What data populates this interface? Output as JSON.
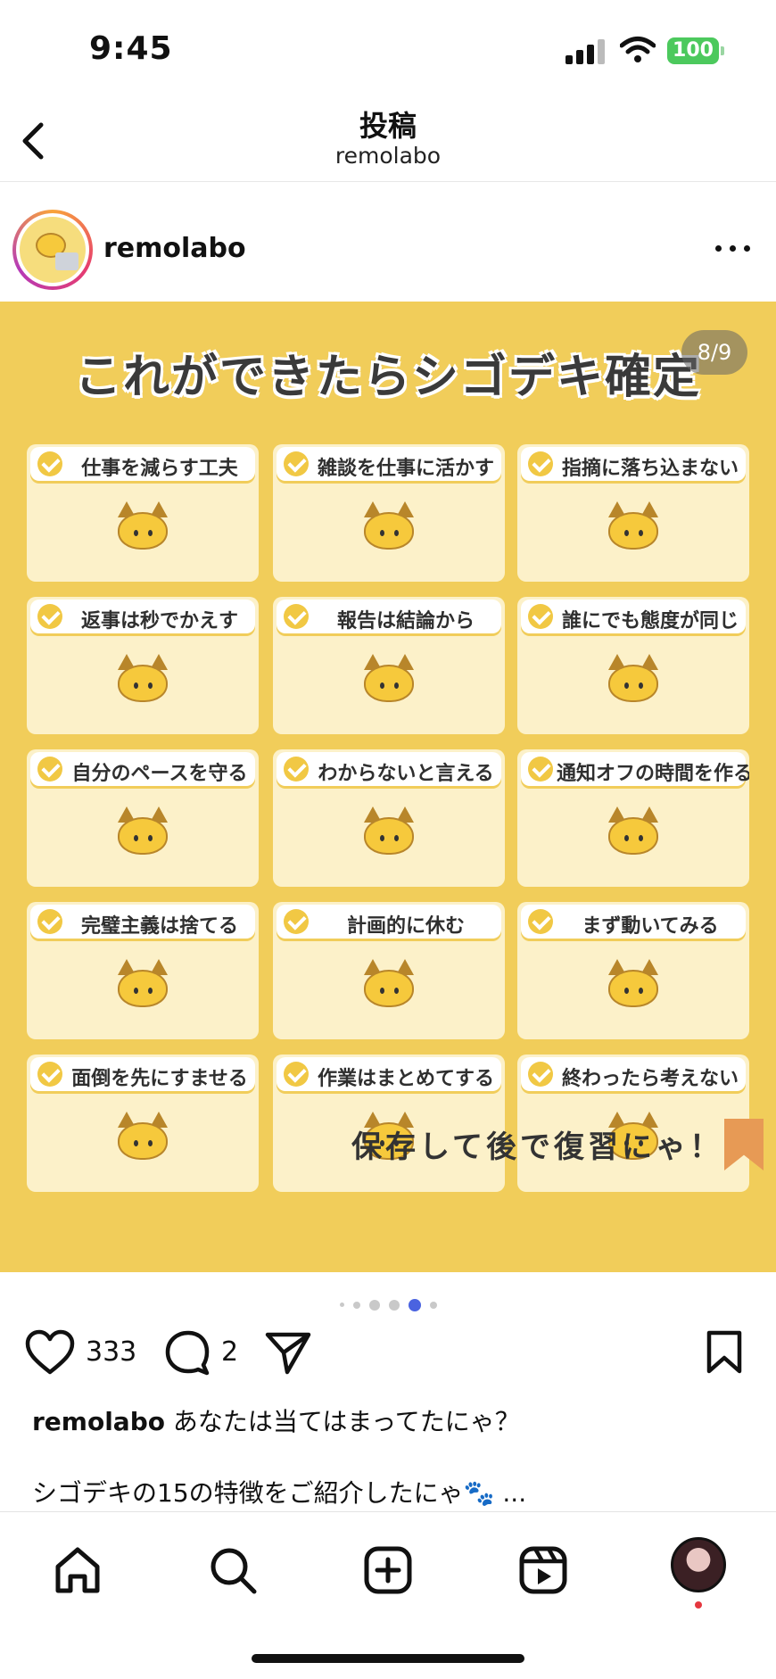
{
  "status_bar": {
    "time": "9:45",
    "battery": "100"
  },
  "header": {
    "title": "投稿",
    "subtitle": "remolabo"
  },
  "post": {
    "username": "remolabo",
    "slide_counter": "8/9",
    "slide_title": "これができたらシゴデキ確定",
    "cards": [
      "仕事を減らす工夫",
      "雑談を仕事に活かす",
      "指摘に落ち込まない",
      "返事は秒でかえす",
      "報告は結論から",
      "誰にでも態度が同じ",
      "自分のペースを守る",
      "わからないと言える",
      "通知オフの時間を作る",
      "完璧主義は捨てる",
      "計画的に休む",
      "まず動いてみる",
      "面倒を先にすませる",
      "作業はまとめてする",
      "終わったら考えない"
    ],
    "slide_footer": "保存して後で復習にゃ！",
    "carousel_active_index": 4,
    "carousel_dots": 6,
    "likes": "333",
    "comments": "2",
    "caption_user": "remolabo",
    "caption_text": "あなたは当てはまってたにゃ？",
    "caption_line2": "シゴデキの15の特徴をご紹介したにゃ🐾 ..."
  },
  "icons": {
    "back": "chevron-left-icon",
    "more": "more-horizontal-icon",
    "like": "heart-icon",
    "comment": "comment-icon",
    "share": "paper-plane-icon",
    "save": "bookmark-icon",
    "tabs": [
      "home-icon",
      "search-icon",
      "create-icon",
      "reels-icon",
      "profile-avatar"
    ]
  },
  "colors": {
    "slide_bg": "#f1cd5a",
    "card_bg": "#fcf1c9",
    "active_dot": "#4a63e0",
    "notification": "#e5373f"
  }
}
